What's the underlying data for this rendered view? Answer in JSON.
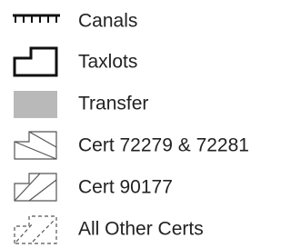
{
  "legend": {
    "items": [
      {
        "label": "Canals",
        "symbol": "canal-line-icon"
      },
      {
        "label": "Taxlots",
        "symbol": "taxlot-outline-icon"
      },
      {
        "label": "Transfer",
        "symbol": "transfer-fill-icon"
      },
      {
        "label": "Cert 72279 & 72281",
        "symbol": "cert-72279-hatch-icon"
      },
      {
        "label": "Cert 90177",
        "symbol": "cert-90177-hatch-icon"
      },
      {
        "label": "All Other Certs",
        "symbol": "other-certs-dashed-icon"
      }
    ],
    "colors": {
      "stroke": "#111111",
      "transfer_fill": "#b9b9b9",
      "cert_outline": "#555555",
      "label_text": "#222222"
    }
  }
}
